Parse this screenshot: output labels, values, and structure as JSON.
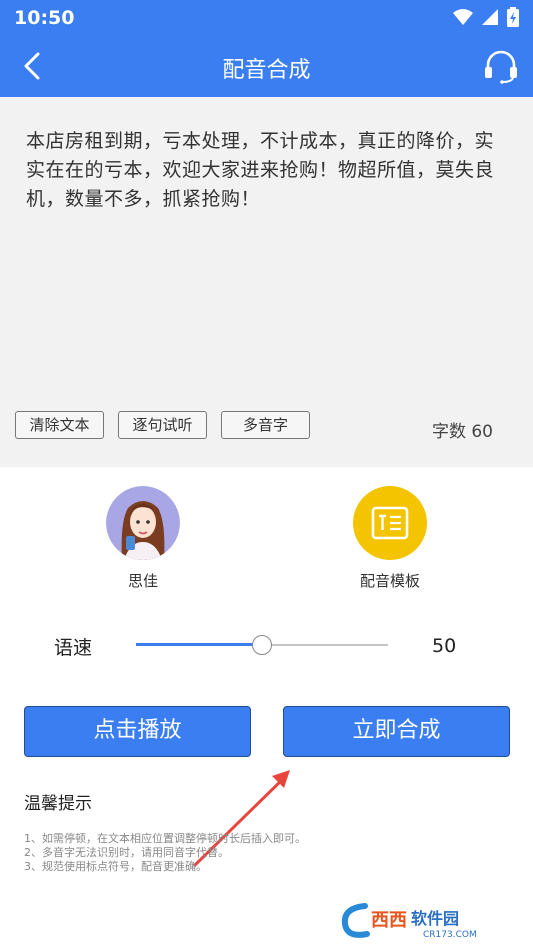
{
  "status_bar": {
    "time": "10:50"
  },
  "header": {
    "title": "配音合成"
  },
  "editor": {
    "text": "本店房租到期，亏本处理，不计成本，真正的降价，实实在在的亏本，欢迎大家进来抢购！物超所值，莫失良机，数量不多，抓紧抢购！",
    "buttons": {
      "clear": "清除文本",
      "sentence_preview": "逐句试听",
      "polyphone": "多音字"
    },
    "count_label": "字数 60"
  },
  "voices": {
    "speaker": "思佳",
    "template": "配音模板"
  },
  "speed": {
    "label": "语速",
    "value": "50",
    "fraction": 0.5
  },
  "actions": {
    "play": "点击播放",
    "synthesize": "立即合成"
  },
  "tips": {
    "title": "温馨提示",
    "items": [
      "1、如需停顿，在文本相应位置调整停顿时长后插入即可。",
      "2、多音字无法识别时，请用同音字代替。",
      "3、规范使用标点符号，配音更准确。"
    ]
  },
  "watermark": {
    "brand": "西西软件园",
    "domain": "CR173.COM"
  },
  "colors": {
    "primary": "#3a7ef2",
    "template_icon_bg": "#f4c400",
    "annotation_arrow": "#e8453c"
  }
}
